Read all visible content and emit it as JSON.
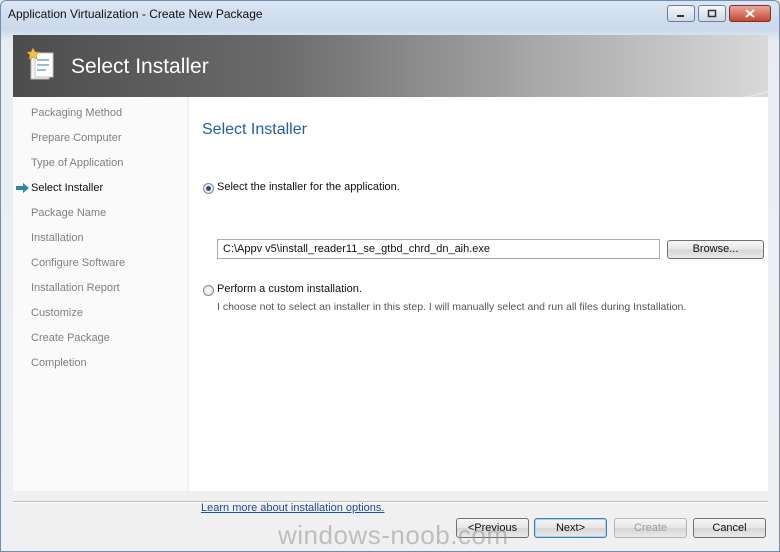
{
  "window": {
    "title": "Application Virtualization - Create New Package",
    "minimize_icon": "minimize-icon",
    "maximize_icon": "maximize-icon",
    "close_icon": "close-icon"
  },
  "banner": {
    "title": "Select Installer",
    "icon": "wizard-icon"
  },
  "sidebar": {
    "items": [
      {
        "label": "Packaging Method",
        "current": false
      },
      {
        "label": "Prepare Computer",
        "current": false
      },
      {
        "label": "Type of Application",
        "current": false
      },
      {
        "label": "Select Installer",
        "current": true
      },
      {
        "label": "Package Name",
        "current": false
      },
      {
        "label": "Installation",
        "current": false
      },
      {
        "label": "Configure Software",
        "current": false
      },
      {
        "label": "Installation Report",
        "current": false
      },
      {
        "label": "Customize",
        "current": false
      },
      {
        "label": "Create Package",
        "current": false
      },
      {
        "label": "Completion",
        "current": false
      }
    ],
    "current_icon": "arrow-right-icon"
  },
  "main": {
    "heading": "Select Installer",
    "option_installer": {
      "label": "Select the installer for the application.",
      "selected": true,
      "path_value": "C:\\Appv v5\\install_reader11_se_gtbd_chrd_dn_aih.exe",
      "browse_label": "Browse..."
    },
    "option_custom": {
      "label": "Perform a custom installation.",
      "selected": false,
      "description": "I choose not to select an installer in this step.  I will manually select and run all files during Installation."
    },
    "learn_more_link": "Learn more about installation options."
  },
  "footer": {
    "previous_label": "<Previous",
    "next_label": "Next>",
    "create_label": "Create",
    "cancel_label": "Cancel"
  },
  "watermark": "windows-noob.com"
}
